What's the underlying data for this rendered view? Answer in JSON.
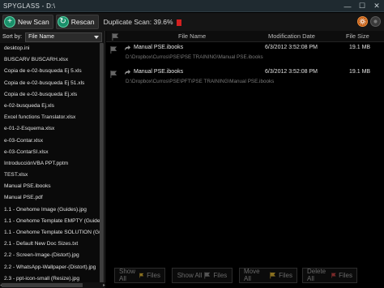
{
  "window": {
    "title": "SPYGLASS - D:\\",
    "minimize_glyph": "—",
    "maximize_glyph": "☐",
    "close_glyph": "✕"
  },
  "toolbar": {
    "new_scan_label": "New Scan",
    "rescan_label": "Rescan",
    "status_text": "Duplicate Scan: 39.6%",
    "plus_glyph": "+",
    "rescan_glyph": "↻"
  },
  "sidebar": {
    "sort_label": "Sort by:",
    "sort_value": "File Name",
    "files": [
      "desktop.ini",
      "BUSCARV BUSCARH.xlsx",
      "Copia de e-02-busqueda Ej 5.xls",
      "Copia de e-02-busqueda Ej 51.xls",
      "Copia de e-02-busqueda Ej.xls",
      "e-02-busqueda Ej.xls",
      "Excel functions Translator.xlsx",
      "e-01-2-Esquema.xlsx",
      "e-03-Contar.xlsx",
      "e-03-ContarSI.xlsx",
      "IntroducciónVBA PPT.pptm",
      "TEST.xlsx",
      "Manual PSE.ibooks",
      "Manual PSE.pdf",
      "1.1 - Onehome Image (Guides).jpg",
      "1.1 - Onehome Template EMPTY (Guides",
      "1.1 - Onehome Template SOLUTION (Guid",
      "2.1 - Default New Doc Sizes.txt",
      "2.2 - Screen-Image-(Distort).jpg",
      "2.2 - WhatsApp-Wallpaper-(Distort).jpg",
      "2.3 - ppt-icon-small (Resize).jpg"
    ]
  },
  "main": {
    "columns": {
      "name": "File Name",
      "date": "Modification Date",
      "size": "File Size"
    },
    "duplicates": [
      {
        "name": "Manual PSE.ibooks",
        "path": "D:\\Dropbox\\Curros\\PSE\\PSE TRAINING\\Manual PSE.ibooks",
        "date": "6/3/2012 3:52:08 PM",
        "size": "19.1 MB"
      },
      {
        "name": "Manual PSE.ibooks",
        "path": "D:\\Dropbox\\Curros\\PSE\\PFT\\PSE TRAINING\\Manual PSE.ibooks",
        "date": "6/3/2012 3:52:08 PM",
        "size": "19.1 MB"
      }
    ]
  },
  "bottom": {
    "show_all_1": "Show All",
    "files_1": "Files",
    "show_all_2": "Show All",
    "files_2": "Files",
    "move_all": "Move All",
    "files_3": "Files",
    "delete_all": "Delete All",
    "files_4": "Files"
  },
  "colors": {
    "accent_green": "#1a8f6a",
    "stop_red": "#d42020",
    "flag_yellow": "#e0b020",
    "flag_red": "#c03030"
  }
}
